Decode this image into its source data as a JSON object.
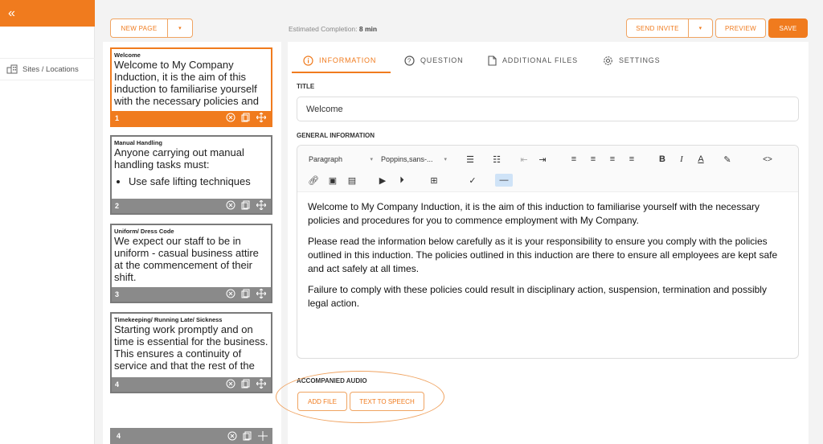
{
  "sidebar": {
    "collapse_glyph": "«",
    "nav_item_label": "Sites / Locations"
  },
  "toolbar": {
    "new_page": "NEW PAGE",
    "estimated_label": "Estimated Completion:",
    "estimated_value": "8 min",
    "send_invite": "SEND INVITE",
    "preview": "PREVIEW",
    "save": "SAVE"
  },
  "pages": [
    {
      "title": "Welcome",
      "body": "Welcome to My Company  Induction, it is the aim of this induction to familiarise yourself with the necessary policies and procedures for",
      "number": "1"
    },
    {
      "title": "Manual Handling",
      "body": "Anyone carrying out manual handling tasks must:",
      "bullet": "Use safe lifting techniques",
      "number": "2"
    },
    {
      "title": "Uniform/ Dress Code",
      "body": "We expect our staff to be in uniform - casual business attire at the commencement of their shift.",
      "number": "3"
    },
    {
      "title": "Timekeeping/ Running Late/ Sickness",
      "body": "Starting work promptly and on time is essential for the business. This ensures a continuity of service and that the rest of the team",
      "number": "4"
    }
  ],
  "bottom_page_number": "4",
  "tabs": [
    {
      "label": "INFORMATION"
    },
    {
      "label": "QUESTION"
    },
    {
      "label": "ADDITIONAL FILES"
    },
    {
      "label": "SETTINGS"
    }
  ],
  "form": {
    "title_label": "TITLE",
    "title_value": "Welcome",
    "general_label": "GENERAL INFORMATION",
    "paragraph_select": "Paragraph",
    "font_select": "Poppins,sans-...",
    "content": [
      "Welcome to My Company  Induction, it is the aim of this induction to familiarise yourself with the necessary policies and procedures for you to commence employment with My Company.",
      "Please read the information below carefully as it is your responsibility to ensure you comply with the policies outlined in this induction. The policies outlined in this induction are there to ensure all employees are kept safe and act safely at all times.",
      "Failure to comply with these policies could result in disciplinary action, suspension, termination and possibly legal action."
    ],
    "audio_label": "ACCOMPANIED AUDIO",
    "add_file": "ADD FILE",
    "text_to_speech": "TEXT TO SPEECH"
  },
  "colors": {
    "accent": "#f07b1e",
    "accent_light": "#f0a462",
    "card_footer": "#8a8a8a"
  },
  "icons": [
    "sites-icon",
    "info-icon",
    "question-icon",
    "file-icon",
    "gear-icon",
    "delete-icon",
    "duplicate-icon",
    "move-icon"
  ]
}
